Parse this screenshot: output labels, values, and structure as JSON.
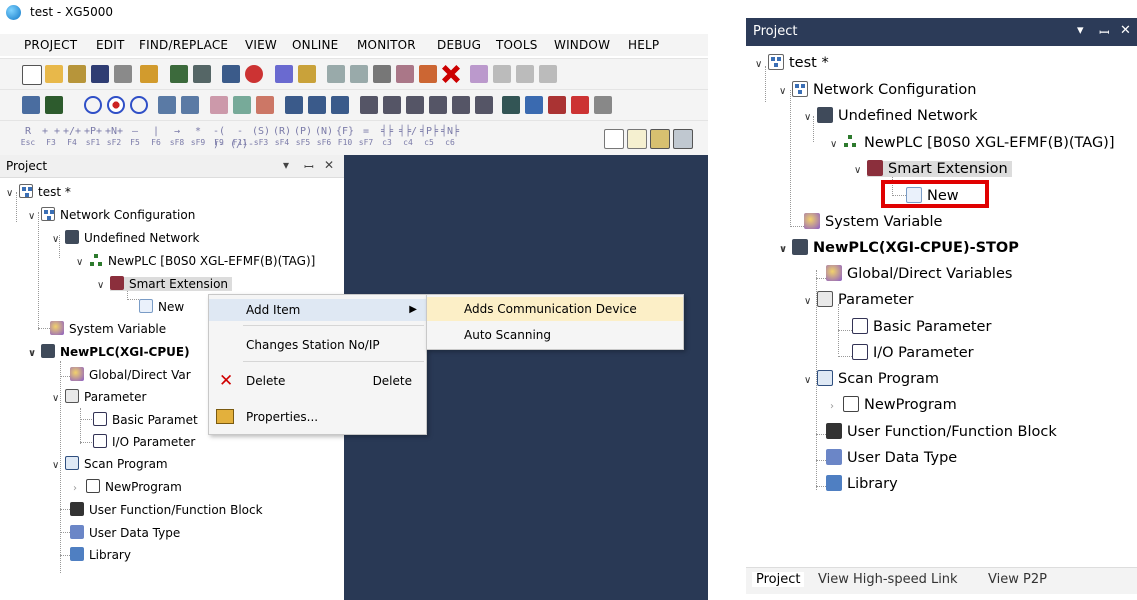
{
  "app": {
    "window_title": "test - XG5000",
    "menu": [
      "PROJECT",
      "EDIT",
      "FIND/REPLACE",
      "VIEW",
      "ONLINE",
      "MONITOR",
      "DEBUG",
      "TOOLS",
      "WINDOW",
      "HELP"
    ]
  },
  "fkeys": [
    {
      "glyph": "R",
      "label": "Esc"
    },
    {
      "glyph": "+ +",
      "label": "F3"
    },
    {
      "glyph": "+/+",
      "label": "F4"
    },
    {
      "glyph": "+P+",
      "label": "sF1"
    },
    {
      "glyph": "+N+",
      "label": "sF2"
    },
    {
      "glyph": "—",
      "label": "F5"
    },
    {
      "glyph": "|",
      "label": "F6"
    },
    {
      "glyph": "→",
      "label": "sF8"
    },
    {
      "glyph": "*",
      "label": "sF9"
    },
    {
      "glyph": "-( )-",
      "label": "F9"
    },
    {
      "glyph": "-(/)-",
      "label": "F11"
    },
    {
      "glyph": "(S)",
      "label": "sF3"
    },
    {
      "glyph": "(R)",
      "label": "sF4"
    },
    {
      "glyph": "(P)",
      "label": "sF5"
    },
    {
      "glyph": "(N)",
      "label": "sF6"
    },
    {
      "glyph": "{F}",
      "label": "F10"
    },
    {
      "glyph": "=",
      "label": "sF7"
    },
    {
      "glyph": "╡╞",
      "label": "c3"
    },
    {
      "glyph": "╡╞/",
      "label": "c4"
    },
    {
      "glyph": "╡P╞",
      "label": "c5"
    },
    {
      "glyph": "╡N╞",
      "label": "c6"
    }
  ],
  "project_panel": {
    "title": "Project",
    "controls": {
      "dropdown": "▾",
      "pin": "ꟷ",
      "close": "✕"
    }
  },
  "tree": {
    "root": "test *",
    "network_config": "Network Configuration",
    "undefined_network": "Undefined Network",
    "newplc_net": "NewPLC [B0S0 XGL-EFMF(B)(TAG)]",
    "smart_extension": "Smart Extension",
    "new_item": "New",
    "system_variable": "System Variable",
    "newplc_left": "NewPLC(XGI-CPUE)",
    "newplc_right": "NewPLC(XGI-CPUE)-STOP",
    "global_vars_left": "Global/Direct Var",
    "global_vars_right": "Global/Direct Variables",
    "parameter": "Parameter",
    "basic_param_left": "Basic Paramet",
    "basic_param_right": "Basic Parameter",
    "io_param": "I/O Parameter",
    "scan_program": "Scan Program",
    "new_program": "NewProgram",
    "user_function": "User Function/Function Block",
    "user_data_type": "User Data Type",
    "library": "Library"
  },
  "context_menu": {
    "add_item": "Add Item",
    "changes_station": "Changes Station No/IP",
    "delete": "Delete",
    "delete_shortcut": "Delete",
    "properties": "Properties..."
  },
  "submenu": {
    "adds_comm_device": "Adds Communication Device",
    "auto_scanning": "Auto Scanning"
  },
  "right_panel": {
    "title": "Project",
    "tabs": [
      "Project",
      "View High-speed Link",
      "View P2P"
    ]
  },
  "colors": {
    "dark_area": "#293955",
    "panel_header": "#2c3b58",
    "highlight_box": "#e00000",
    "submenu_highlight": "#fcefc7"
  }
}
